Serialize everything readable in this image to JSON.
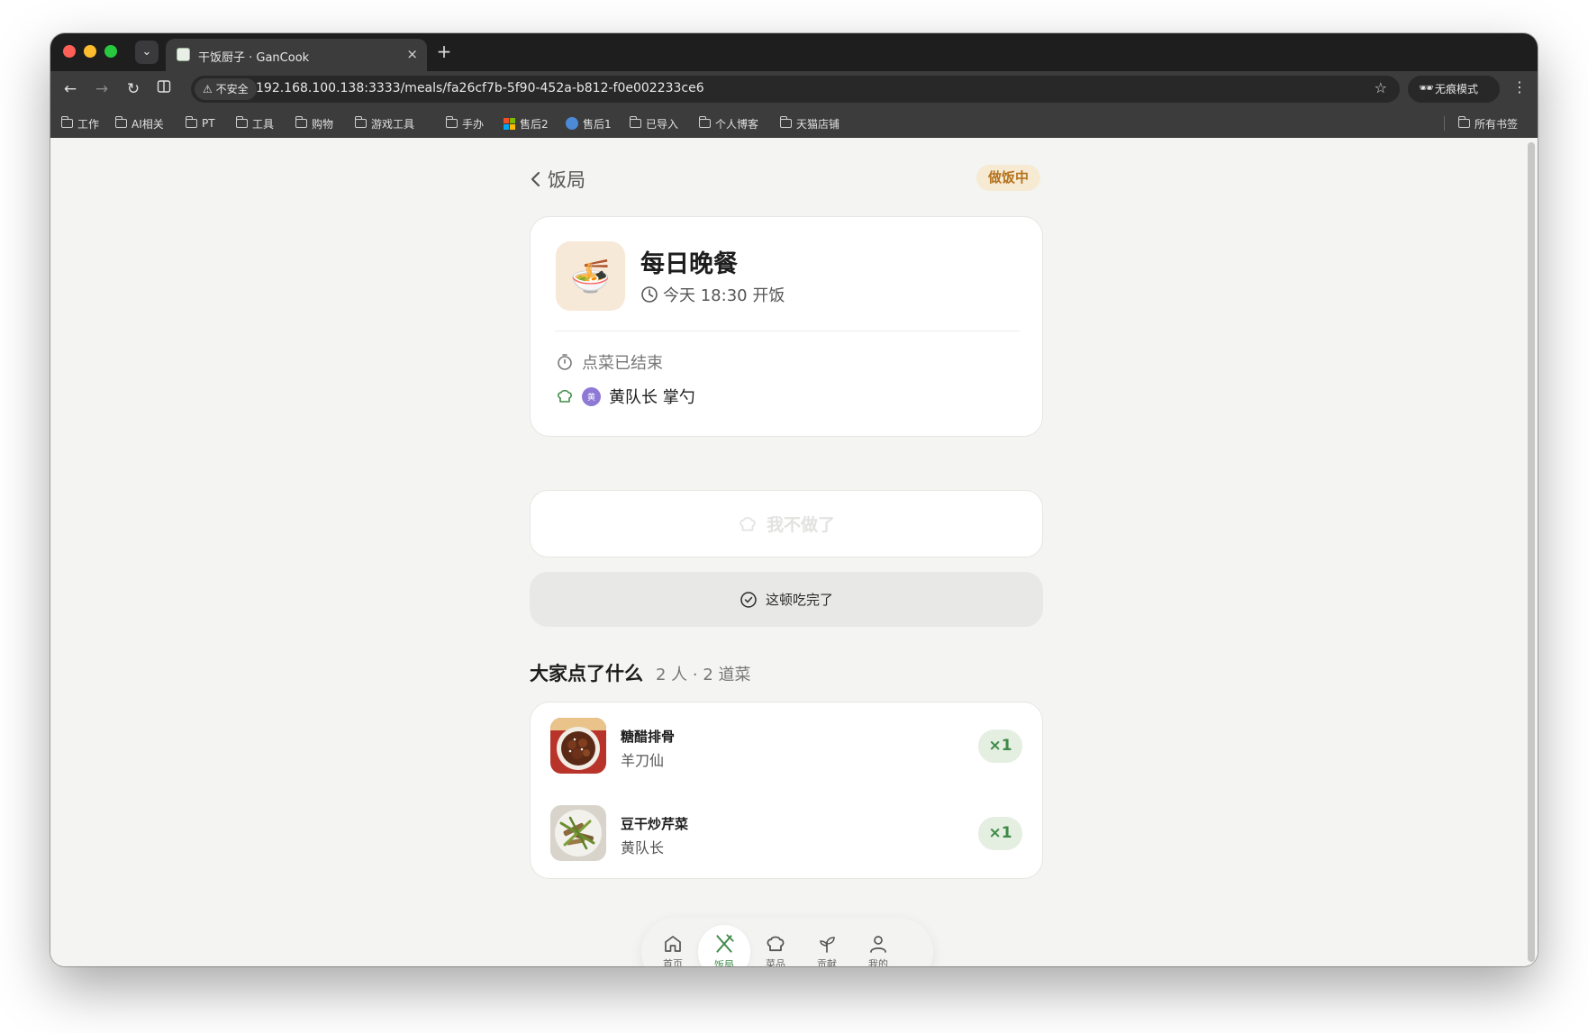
{
  "browser": {
    "tab_title": "干饭厨子 · GanCook",
    "tab_close": "×",
    "new_tab": "+",
    "security_label": "不安全",
    "url": "192.168.100.138:3333/meals/fa26cf7b-5f90-452a-b812-f0e002233ce6",
    "incognito_label": "无痕模式",
    "bookmarks": [
      "工作",
      "AI相关",
      "PT",
      "工具",
      "购物",
      "游戏工具",
      "手办",
      "售后2",
      "售后1",
      "已导入",
      "个人博客",
      "天猫店铺"
    ],
    "all_bookmarks_label": "所有书签"
  },
  "page": {
    "back_label": "饭局",
    "status_badge": "做饭中",
    "meal": {
      "icon": "🍜",
      "title": "每日晚餐",
      "time": "今天 18:30 开饭",
      "ordering_status": "点菜已结束",
      "chef_avatar_initial": "黄",
      "chef_label": "黄队长 掌勺"
    },
    "quit_button_label": "我不做了",
    "done_button_label": "这顿吃完了",
    "orders_section": {
      "title": "大家点了什么",
      "count": "2 人 · 2 道菜",
      "dishes": [
        {
          "name": "糖醋排骨",
          "orderer": "羊刀仙",
          "qty": "×1"
        },
        {
          "name": "豆干炒芹菜",
          "orderer": "黄队长",
          "qty": "×1"
        }
      ]
    },
    "nav": {
      "home": "首页",
      "meals": "饭局",
      "dishes": "菜品",
      "contribute": "贡献",
      "mine": "我的"
    }
  },
  "colors": {
    "accent_green": "#3f8a47",
    "status_badge_text": "#b4731f",
    "status_badge_bg": "#f6ead3"
  }
}
